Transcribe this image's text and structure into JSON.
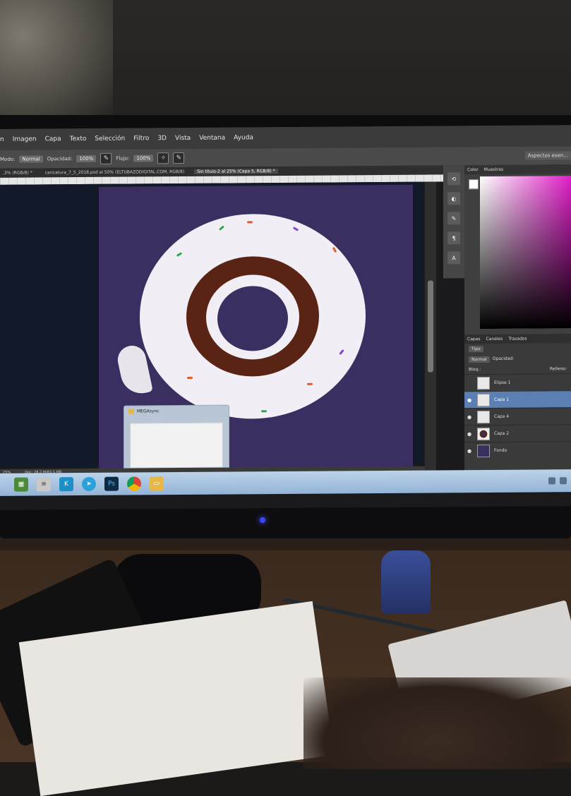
{
  "menu": {
    "items": [
      "n",
      "Imagen",
      "Capa",
      "Texto",
      "Selección",
      "Filtro",
      "3D",
      "Vista",
      "Ventana",
      "Ayuda"
    ]
  },
  "options": {
    "mode_label": "Modo:",
    "mode_value": "Normal",
    "opacity_label": "Opacidad:",
    "opacity_value": "100%",
    "flow_label": "Flujo:",
    "flow_value": "100%",
    "workspace_label": "Aspectos esen..."
  },
  "tabs": [
    {
      "label": ",3% (RGB/8) *"
    },
    {
      "label": "caricatura_7_5_2018.psd al 50% (ELTUBAZODIGITAL.COM, RGB/8)"
    },
    {
      "label": "Sin título-2 al 25% (Capa 5, RGB/8) *"
    }
  ],
  "status": {
    "zoom": "25%",
    "doc": "Doc: 28,2 M/83,5 MB"
  },
  "thumbnail_popup": {
    "title": "MEGAsync"
  },
  "panels": {
    "color_tabs": [
      "Color",
      "Muestras"
    ],
    "layers_tabs": [
      "Capas",
      "Canales",
      "Trazados"
    ],
    "filter_label": "Tipo",
    "blend_mode": "Normal",
    "opacity_label": "Opacidad:",
    "lock_label": "Bloq.:",
    "fill_label": "Relleno:",
    "layers": [
      {
        "name": "Elipse 1",
        "visible": false,
        "selected": false
      },
      {
        "name": "Capa 1",
        "visible": true,
        "selected": true
      },
      {
        "name": "Capa 4",
        "visible": true,
        "selected": false
      },
      {
        "name": "Capa 2",
        "visible": true,
        "selected": false
      },
      {
        "name": "Fondo",
        "visible": true,
        "selected": false
      }
    ]
  },
  "tools": [
    "history-icon",
    "adjust-icon",
    "brush-preset-icon",
    "paragraph-icon",
    "character-icon"
  ],
  "taskbar": {
    "apps": [
      "explorer",
      "notepad",
      "kodi",
      "telegram",
      "photoshop",
      "chrome",
      "folder"
    ]
  },
  "colors": {
    "canvas_bg": "#3b2f62",
    "chocolate": "#5a2415",
    "icing": "#f1eef6",
    "selected_layer": "#5b7fb3"
  }
}
